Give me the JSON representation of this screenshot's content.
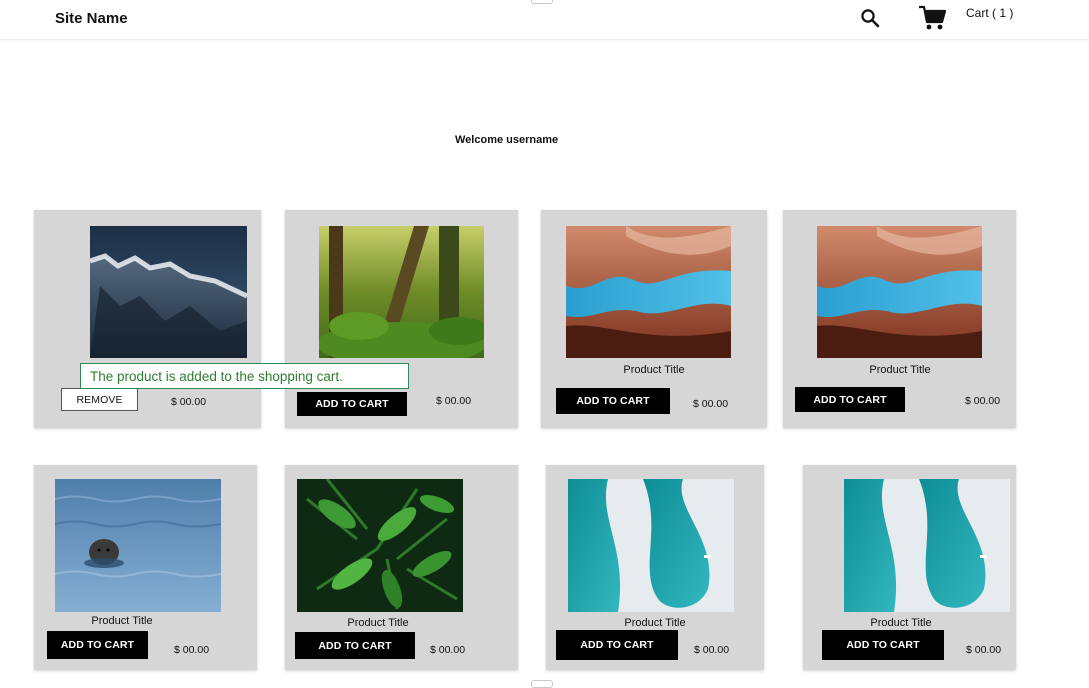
{
  "header": {
    "site_name": "Site Name",
    "search_icon": "search-icon",
    "cart_icon": "shopping-cart-icon",
    "cart_label": "Cart ( 1 )"
  },
  "welcome_text": "Welcome username",
  "notification": "The product is added to the shopping cart.",
  "colors": {
    "card_bg": "#d6d6d6",
    "button_bg": "#000000",
    "toast_border": "#2e8b57",
    "toast_text": "#2e7d32"
  },
  "products": [
    {
      "image": "snowy-mountain-photo",
      "title": "",
      "button": "REMOVE",
      "price": "$ 00.00"
    },
    {
      "image": "mossy-forest-photo",
      "title": "tle",
      "button": "ADD TO CART",
      "price": "$ 00.00"
    },
    {
      "image": "red-canyon-sky-photo",
      "title": "Product Title",
      "button": "ADD TO CART",
      "price": "$ 00.00"
    },
    {
      "image": "red-canyon-sky-photo",
      "title": "Product Title",
      "button": "ADD TO CART",
      "price": "$ 00.00"
    },
    {
      "image": "seal-in-water-photo",
      "title": "Product Title",
      "button": "ADD TO CART",
      "price": "$ 00.00"
    },
    {
      "image": "green-ferns-photo",
      "title": "Product Title",
      "button": "ADD TO CART",
      "price": "$ 00.00"
    },
    {
      "image": "glacier-water-aerial-photo",
      "title": "Product Title",
      "button": "ADD TO CART",
      "price": "$ 00.00"
    },
    {
      "image": "glacier-water-aerial-photo",
      "title": "Product Title",
      "button": "ADD TO CART",
      "price": "$ 00.00"
    }
  ]
}
